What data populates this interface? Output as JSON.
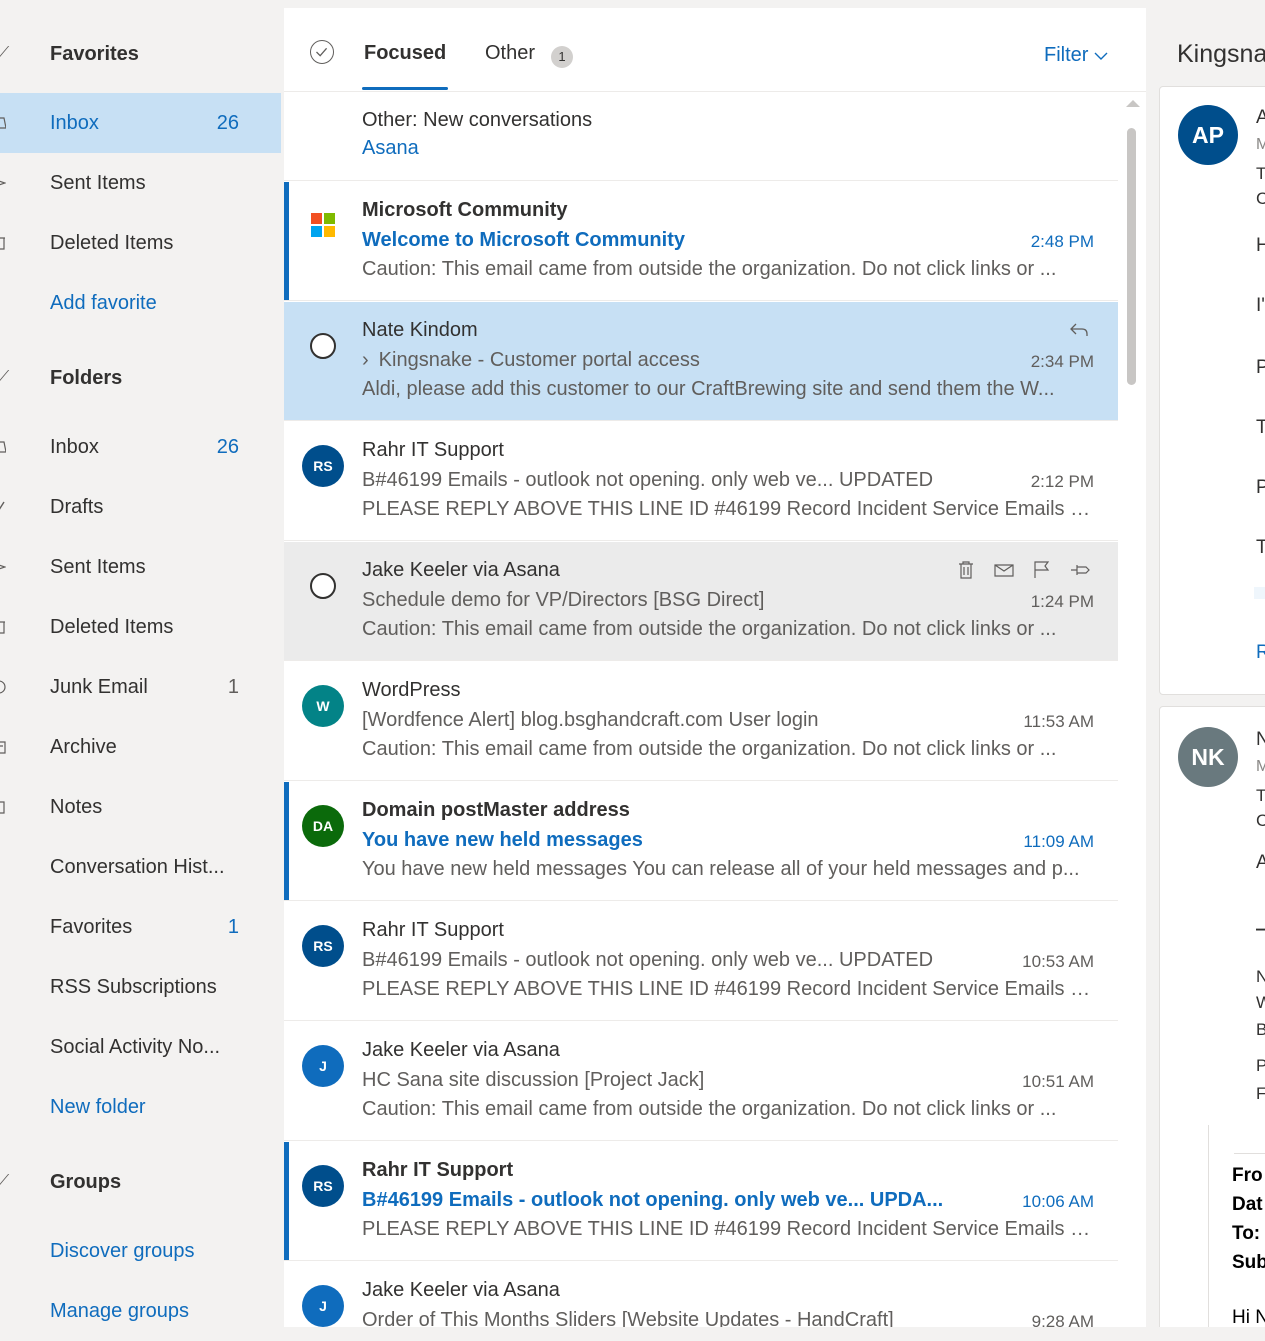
{
  "nav": {
    "favorites_heading": "Favorites",
    "favorites": [
      {
        "label": "Inbox",
        "count": "26"
      },
      {
        "label": "Sent Items",
        "count": ""
      },
      {
        "label": "Deleted Items",
        "count": ""
      }
    ],
    "add_favorite": "Add favorite",
    "folders_heading": "Folders",
    "folders": [
      {
        "label": "Inbox",
        "count": "26"
      },
      {
        "label": "Drafts",
        "count": ""
      },
      {
        "label": "Sent Items",
        "count": ""
      },
      {
        "label": "Deleted Items",
        "count": ""
      },
      {
        "label": "Junk Email",
        "count": "1"
      },
      {
        "label": "Archive",
        "count": ""
      },
      {
        "label": "Notes",
        "count": ""
      },
      {
        "label": "Conversation Hist...",
        "count": ""
      },
      {
        "label": "Favorites",
        "count": "1"
      },
      {
        "label": "RSS Subscriptions",
        "count": ""
      },
      {
        "label": "Social Activity No...",
        "count": ""
      }
    ],
    "new_folder": "New folder",
    "groups_heading": "Groups",
    "discover_groups": "Discover groups",
    "manage_groups": "Manage groups"
  },
  "list": {
    "tabs": {
      "focused": "Focused",
      "other": "Other",
      "other_badge": "1"
    },
    "filter_label": "Filter",
    "group_header": {
      "title": "Other: New conversations",
      "link": "Asana"
    },
    "messages": [
      {
        "sender": "Microsoft Community",
        "subject": "Welcome to Microsoft Community",
        "time": "2:48 PM",
        "preview": "Caution: This email came from outside the organization. Do not click links or ...",
        "avatar": ""
      },
      {
        "sender": "Nate Kindom",
        "subject": "Kingsnake - Customer portal access",
        "time": "2:34 PM",
        "preview": "Aldi, please add this customer to our CraftBrewing site and send them the W...",
        "avatar": ""
      },
      {
        "sender": "Rahr IT Support",
        "subject": "B#46199 Emails - outlook not opening. only web ve... UPDATED",
        "time": "2:12 PM",
        "preview": "PLEASE REPLY ABOVE THIS LINE ID #46199 Record Incident Service Emails ou...",
        "avatar": "RS"
      },
      {
        "sender": "Jake Keeler via Asana",
        "subject": "Schedule demo for VP/Directors [BSG Direct]",
        "time": "1:24 PM",
        "preview": "Caution: This email came from outside the organization. Do not click links or ...",
        "avatar": ""
      },
      {
        "sender": "WordPress",
        "subject": "[Wordfence Alert] blog.bsghandcraft.com User login",
        "time": "11:53 AM",
        "preview": "Caution: This email came from outside the organization. Do not click links or ...",
        "avatar": "W"
      },
      {
        "sender": "Domain postMaster address",
        "subject": "You have new held messages",
        "time": "11:09 AM",
        "preview": "You have new held messages You can release all of your held messages and p...",
        "avatar": "DA"
      },
      {
        "sender": "Rahr IT Support",
        "subject": "B#46199 Emails - outlook not opening. only web ve... UPDATED",
        "time": "10:53 AM",
        "preview": "PLEASE REPLY ABOVE THIS LINE ID #46199 Record Incident Service Emails ou...",
        "avatar": "RS"
      },
      {
        "sender": "Jake Keeler via Asana",
        "subject": "HC Sana site discussion [Project Jack]",
        "time": "10:51 AM",
        "preview": "Caution: This email came from outside the organization. Do not click links or ...",
        "avatar": "J"
      },
      {
        "sender": "Rahr IT Support",
        "subject": "B#46199 Emails - outlook not opening. only web ve... UPDA...",
        "time": "10:06 AM",
        "preview": "PLEASE REPLY ABOVE THIS LINE ID #46199 Record Incident Service Emails ou...",
        "avatar": "RS"
      },
      {
        "sender": "Jake Keeler via Asana",
        "subject": "Order of This Months Sliders [Website Updates - HandCraft]",
        "time": "9:28 AM",
        "preview": "",
        "avatar": "J"
      }
    ]
  },
  "reading": {
    "title": "Kingsna",
    "card1": {
      "avatar": "AP",
      "fragments": [
        "A",
        "M",
        "T",
        "C",
        "H",
        "I'",
        "P",
        "T",
        "P",
        "T",
        "R"
      ]
    },
    "card2": {
      "avatar": "NK",
      "fragments": [
        "N",
        "M",
        "T",
        "C",
        "A",
        "—",
        "N",
        "W",
        "B",
        "P",
        "F"
      ],
      "quoted": [
        "Fro",
        "Dat",
        "To:",
        "Sub"
      ],
      "greeting": "Hi N"
    }
  },
  "colors": {
    "accent": "#0f6cbd",
    "selected_bg": "#c7e0f4",
    "avatar_rs": "#004e8c",
    "avatar_w": "#038387",
    "avatar_da": "#0b6a0b",
    "avatar_j": "#0f6cbd",
    "avatar_ap": "#004e8c",
    "avatar_nk": "#69797e"
  }
}
